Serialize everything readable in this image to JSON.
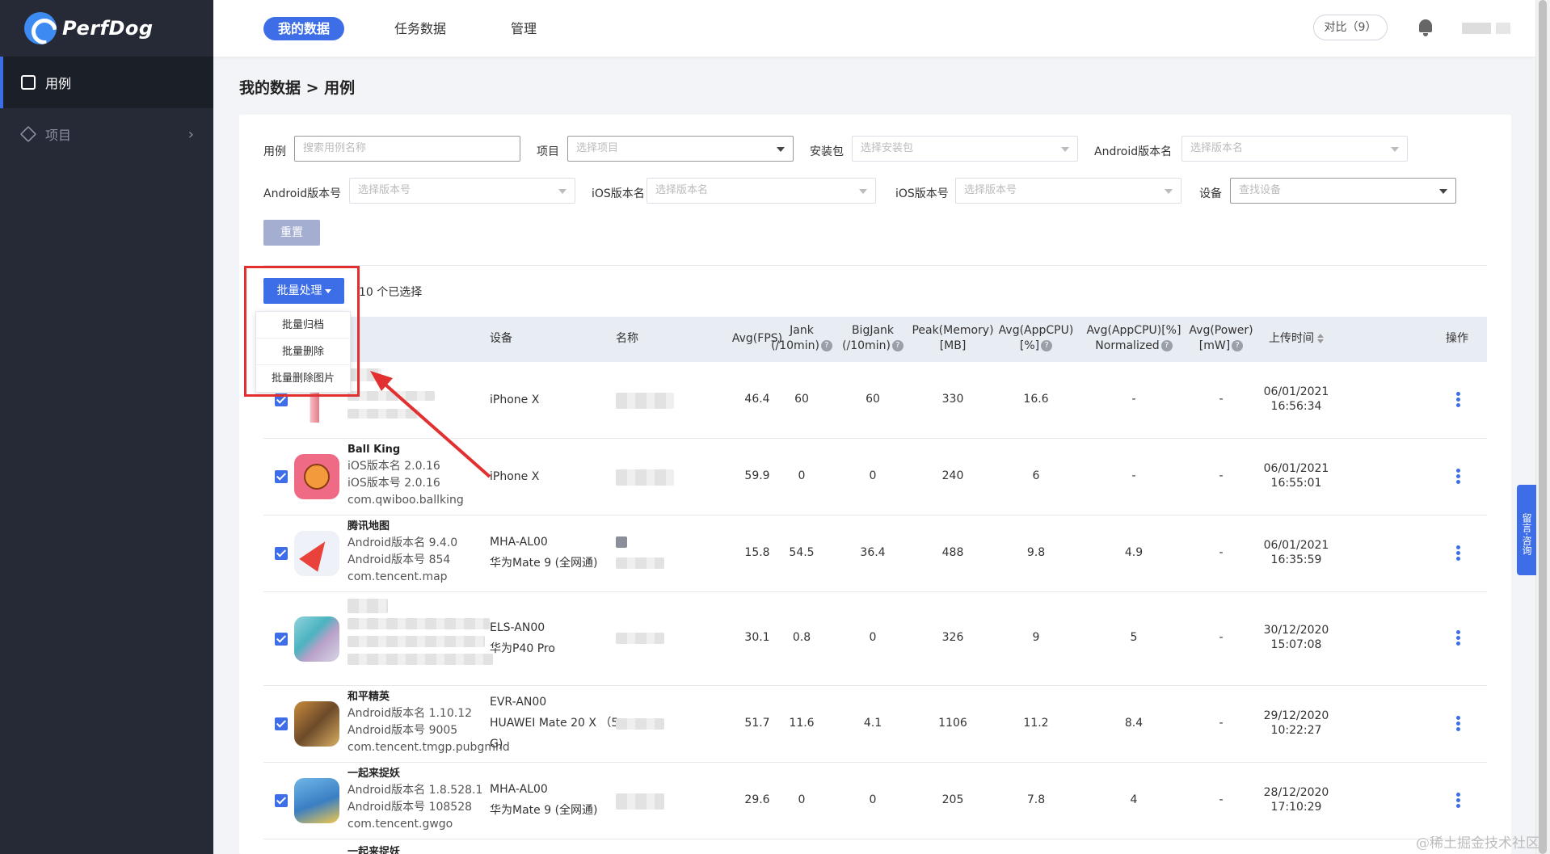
{
  "app": {
    "name": "PerfDog"
  },
  "sidebar": {
    "items": [
      {
        "label": "用例"
      },
      {
        "label": "项目"
      }
    ]
  },
  "topnav": {
    "tabs": [
      {
        "label": "我的数据"
      },
      {
        "label": "任务数据"
      },
      {
        "label": "管理"
      }
    ],
    "compare_label": "对比（9）"
  },
  "breadcrumb": "我的数据 > 用例",
  "filters": {
    "case_label": "用例",
    "case_placeholder": "搜索用例名称",
    "project_label": "项目",
    "project_placeholder": "选择项目",
    "package_label": "安装包",
    "package_placeholder": "选择安装包",
    "android_name_label": "Android版本名",
    "android_name_placeholder": "选择版本名",
    "android_code_label": "Android版本号",
    "android_code_placeholder": "选择版本号",
    "ios_name_label": "iOS版本名",
    "ios_name_placeholder": "选择版本名",
    "ios_code_label": "iOS版本号",
    "ios_code_placeholder": "选择版本号",
    "device_label": "设备",
    "device_placeholder": "查找设备",
    "reset_label": "重置"
  },
  "batch": {
    "button_label": "批量处理",
    "selected_text": "10 个已选择",
    "menu": [
      "批量归档",
      "批量删除",
      "批量删除图片"
    ]
  },
  "table": {
    "headers": {
      "device": "设备",
      "name": "名称",
      "fps": "Avg(FPS)",
      "jank_1": "Jank",
      "jank_2": "(/10min)",
      "bigjank_1": "BigJank",
      "bigjank_2": "(/10min)",
      "mem_1": "Peak(Memory)",
      "mem_2": "[MB]",
      "cpu_1": "Avg(AppCPU)",
      "cpu_2": "[%]",
      "cpun_1": "Avg(AppCPU)[%]",
      "cpun_2": "Normalized",
      "power_1": "Avg(Power)",
      "power_2": "[mW]",
      "time": "上传时间",
      "ops": "操作"
    },
    "rows": [
      {
        "title": "",
        "line1": "",
        "line2": "",
        "line3": "",
        "device1": "iPhone X",
        "device2": "",
        "fps": "46.4",
        "jank": "60",
        "bigjank": "60",
        "mem": "330",
        "cpu": "16.6",
        "cpun": "-",
        "power": "-",
        "date": "06/01/2021",
        "time": "16:56:34"
      },
      {
        "title": "Ball King",
        "line1": "iOS版本名 2.0.16",
        "line2": "iOS版本号 2.0.16",
        "line3": "com.qwiboo.ballking",
        "device1": "iPhone X",
        "device2": "",
        "fps": "59.9",
        "jank": "0",
        "bigjank": "0",
        "mem": "240",
        "cpu": "6",
        "cpun": "-",
        "power": "-",
        "date": "06/01/2021",
        "time": "16:55:01"
      },
      {
        "title": "腾讯地图",
        "line1": "Android版本名 9.4.0",
        "line2": "Android版本号 854",
        "line3": "com.tencent.map",
        "device1": "MHA-AL00",
        "device2": "华为Mate 9 (全网通)",
        "fps": "15.8",
        "jank": "54.5",
        "bigjank": "36.4",
        "mem": "488",
        "cpu": "9.8",
        "cpun": "4.9",
        "power": "-",
        "date": "06/01/2021",
        "time": "16:35:59"
      },
      {
        "title": "",
        "line1": "",
        "line2": "",
        "line3": "",
        "device1": "ELS-AN00",
        "device2": "华为P40 Pro",
        "fps": "30.1",
        "jank": "0.8",
        "bigjank": "0",
        "mem": "326",
        "cpu": "9",
        "cpun": "5",
        "power": "-",
        "date": "30/12/2020",
        "time": "15:07:08"
      },
      {
        "title": "和平精英",
        "line1": "Android版本名 1.10.12",
        "line2": "Android版本号 9005",
        "line3": "com.tencent.tmgp.pubgmhd",
        "device1": "EVR-AN00",
        "device2": "HUAWEI Mate 20 X （5",
        "device3": "G)",
        "fps": "51.7",
        "jank": "11.6",
        "bigjank": "4.1",
        "mem": "1106",
        "cpu": "11.2",
        "cpun": "8.4",
        "power": "-",
        "date": "29/12/2020",
        "time": "10:22:27"
      },
      {
        "title": "一起来捉妖",
        "line1": "Android版本名 1.8.528.1",
        "line2": "Android版本号 108528",
        "line3": "com.tencent.gwgo",
        "device1": "MHA-AL00",
        "device2": "华为Mate 9 (全网通)",
        "fps": "29.6",
        "jank": "0",
        "bigjank": "0",
        "mem": "205",
        "cpu": "7.8",
        "cpun": "4",
        "power": "-",
        "date": "28/12/2020",
        "time": "17:10:29"
      },
      {
        "title": "一起来捉妖"
      }
    ]
  },
  "feedback_label": "留言·咨询",
  "watermark": "@稀土掘金技术社区"
}
